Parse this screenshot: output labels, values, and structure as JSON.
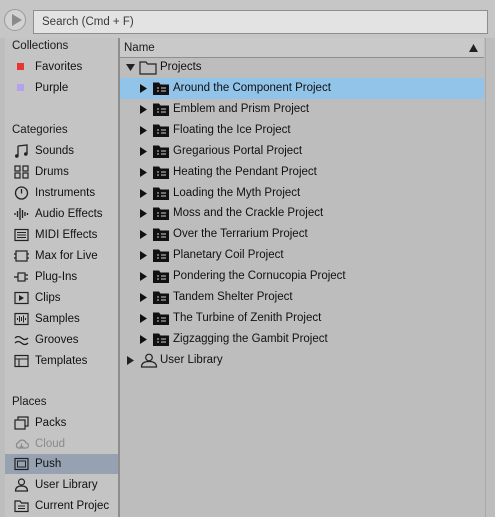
{
  "search": {
    "placeholder": "Search (Cmd + F)"
  },
  "sidebar": {
    "collections_title": "Collections",
    "collections": [
      {
        "label": "Favorites",
        "color": "#e8352e"
      },
      {
        "label": "Purple",
        "color": "#b4a2ef"
      }
    ],
    "categories_title": "Categories",
    "categories": [
      {
        "label": "Sounds",
        "icon": "music-note-icon"
      },
      {
        "label": "Drums",
        "icon": "drum-grid-icon"
      },
      {
        "label": "Instruments",
        "icon": "clock-icon"
      },
      {
        "label": "Audio Effects",
        "icon": "waveform-icon"
      },
      {
        "label": "MIDI Effects",
        "icon": "midi-effects-icon"
      },
      {
        "label": "Max for Live",
        "icon": "max-for-live-icon"
      },
      {
        "label": "Plug-Ins",
        "icon": "plug-icon"
      },
      {
        "label": "Clips",
        "icon": "clip-icon"
      },
      {
        "label": "Samples",
        "icon": "samples-icon"
      },
      {
        "label": "Grooves",
        "icon": "grooves-icon"
      },
      {
        "label": "Templates",
        "icon": "templates-icon"
      }
    ],
    "places_title": "Places",
    "places": [
      {
        "label": "Packs",
        "icon": "packs-icon"
      },
      {
        "label": "Cloud",
        "icon": "cloud-icon",
        "disabled": true
      },
      {
        "label": "Push",
        "icon": "push-icon",
        "selected": true
      },
      {
        "label": "User Library",
        "icon": "user-icon"
      },
      {
        "label": "Current Projec",
        "icon": "project-folder-icon"
      }
    ]
  },
  "browser": {
    "column_header": "Name",
    "root_folder": "Projects",
    "projects": [
      "Around the Component Project",
      "Emblem and Prism Project",
      "Floating the Ice Project",
      "Gregarious Portal Project",
      "Heating the Pendant Project",
      "Loading the Myth Project",
      "Moss and the Crackle Project",
      "Over the Terrarium Project",
      "Planetary Coil Project",
      "Pondering the Cornucopia Project",
      "Tandem Shelter Project",
      "The Turbine of Zenith Project",
      "Zigzagging the Gambit Project"
    ],
    "selected_index": 0,
    "user_library": "User Library"
  },
  "colors": {
    "selection": "#92c3e8",
    "sidebar_selection": "#96a2b2"
  }
}
